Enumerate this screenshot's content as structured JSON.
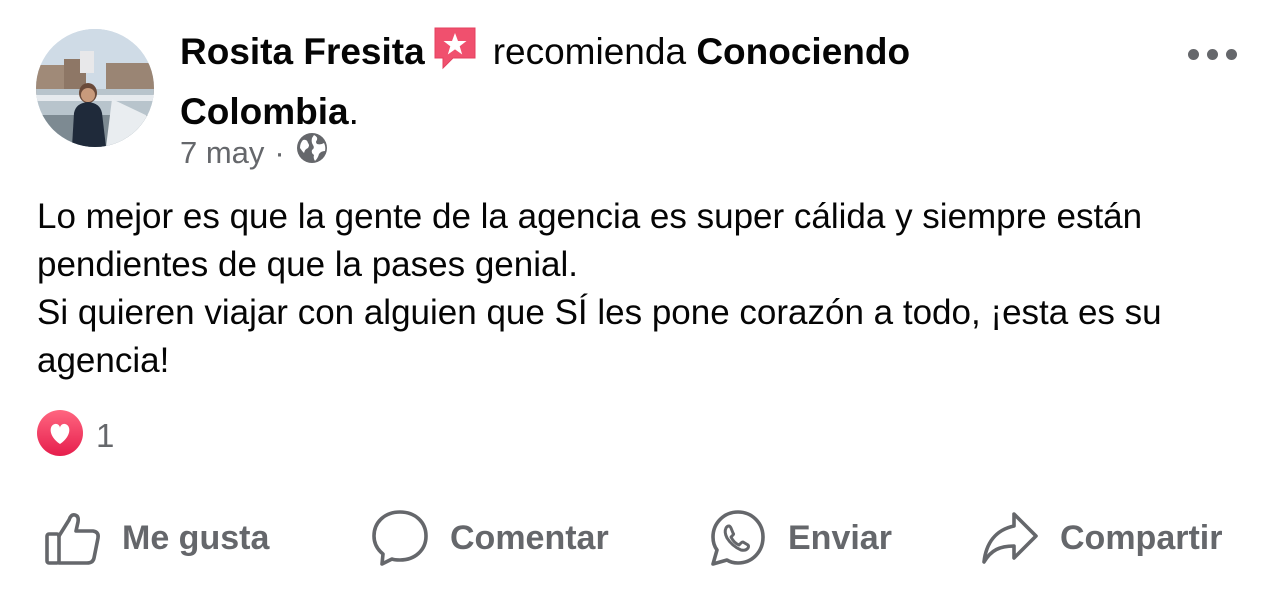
{
  "post": {
    "author": "Rosita Fresita",
    "recommends_word": "recomienda",
    "page_name": "Conociendo Colombia",
    "period": ".",
    "date": "7 may",
    "separator": "·",
    "audience_icon": "globe-icon",
    "recommend_icon": "star-speech-bubble-icon",
    "body": [
      "Lo mejor es que la gente de la agencia es super cálida y siempre están pendientes de que la pases genial.",
      "Si quieren viajar con alguien que SÍ les pone corazón a todo, ¡esta es su agencia!"
    ]
  },
  "reactions": {
    "icon": "heart-reaction-icon",
    "count": "1"
  },
  "actions": [
    {
      "label": "Me gusta",
      "icon": "thumbs-up-icon"
    },
    {
      "label": "Comentar",
      "icon": "comment-icon"
    },
    {
      "label": "Enviar",
      "icon": "whatsapp-icon"
    },
    {
      "label": "Compartir",
      "icon": "share-arrow-icon"
    }
  ],
  "colors": {
    "text": "#050505",
    "secondary": "#65676b",
    "recommend_red": "#f0506e",
    "heart_red": "#f33e58"
  }
}
